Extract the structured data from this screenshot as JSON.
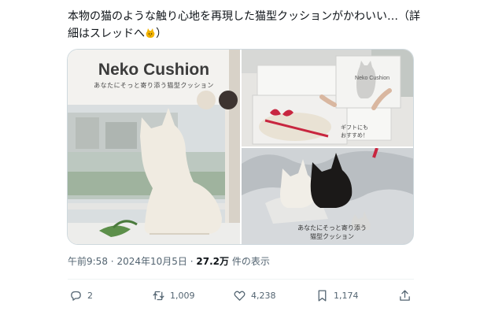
{
  "tweet": {
    "text": "本物の猫のような触り心地を再現した猫型クッションがかわいい…（詳細はスレッドへ",
    "text_end": "）",
    "emoji_icon": "cat-emoji"
  },
  "media": {
    "left": {
      "title": "Neko Cushion",
      "subtitle": "あなたにそっと寄り添う猫型クッション"
    },
    "top_right": {
      "box_brand": "Neko Cushion",
      "gift_line1": "ギフトにも",
      "gift_line2": "おすすめ！"
    },
    "bottom_right": {
      "caption_line1": "あなたにそっと寄り添う",
      "caption_line2": "猫型クッション"
    }
  },
  "meta": {
    "time": "午前9:58",
    "separator": "·",
    "date": "2024年10月5日",
    "views_count": "27.2万",
    "views_label": "件の表示"
  },
  "actions": {
    "replies": "2",
    "retweets": "1,009",
    "likes": "4,238",
    "bookmarks": "1,174"
  },
  "colors": {
    "text": "#0f1419",
    "secondary": "#536471",
    "border": "#cfd9de",
    "ribbon": "#c8263f"
  }
}
